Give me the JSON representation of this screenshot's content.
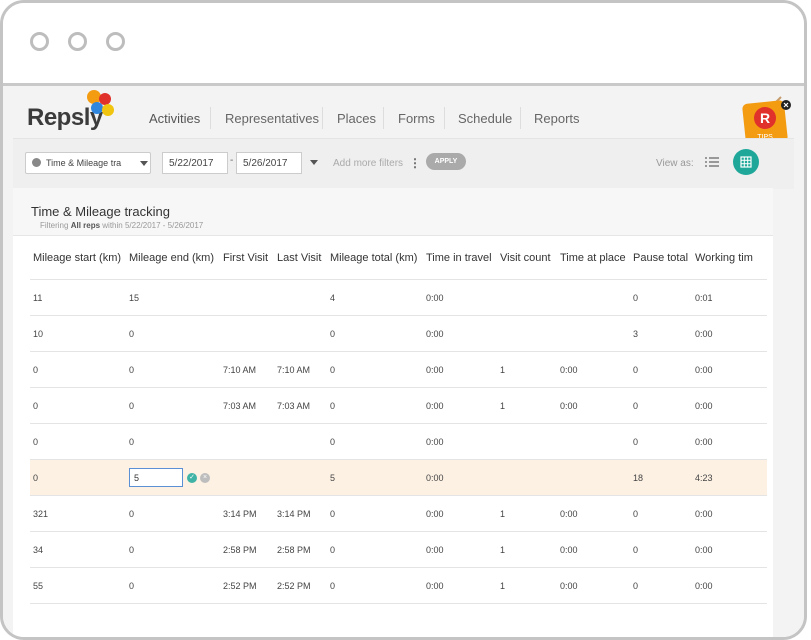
{
  "app": {
    "logo": "Repsly"
  },
  "nav": {
    "items": [
      "Activities",
      "Representatives",
      "Places",
      "Forms",
      "Schedule",
      "Reports"
    ]
  },
  "tips": {
    "label": "TIPS",
    "letter": "R"
  },
  "filters": {
    "report_select": "Time & Mileage tra",
    "date_from": "5/22/2017",
    "date_sep": "-",
    "date_to": "5/26/2017",
    "add_more": "Add more filters",
    "apply": "APPLY",
    "view_as": "View as:"
  },
  "panel": {
    "title": "Time & Mileage tracking",
    "subtitle_prefix": "Filtering",
    "subtitle_reps": "All reps",
    "subtitle_within": "within",
    "subtitle_range": "5/22/2017 - 5/26/2017"
  },
  "table": {
    "columns": [
      "Mileage start (km)",
      "Mileage end (km)",
      "First Visit",
      "Last Visit",
      "Mileage total (km)",
      "Time in travel",
      "Visit count",
      "Time at place",
      "Pause total",
      "Working tim"
    ],
    "rows": [
      [
        "11",
        "15",
        "",
        "",
        "4",
        "0:00",
        "",
        "",
        "0",
        "0:01"
      ],
      [
        "10",
        "0",
        "",
        "",
        "0",
        "0:00",
        "",
        "",
        "3",
        "0:00"
      ],
      [
        "0",
        "0",
        "7:10 AM",
        "7:10 AM",
        "0",
        "0:00",
        "1",
        "0:00",
        "0",
        "0:00"
      ],
      [
        "0",
        "0",
        "7:03 AM",
        "7:03 AM",
        "0",
        "0:00",
        "1",
        "0:00",
        "0",
        "0:00"
      ],
      [
        "0",
        "0",
        "",
        "",
        "0",
        "0:00",
        "",
        "",
        "0",
        "0:00"
      ],
      [
        "0",
        "5",
        "",
        "",
        "5",
        "0:00",
        "",
        "",
        "18",
        "4:23"
      ],
      [
        "321",
        "0",
        "3:14 PM",
        "3:14 PM",
        "0",
        "0:00",
        "1",
        "0:00",
        "0",
        "0:00"
      ],
      [
        "34",
        "0",
        "2:58 PM",
        "2:58 PM",
        "0",
        "0:00",
        "1",
        "0:00",
        "0",
        "0:00"
      ],
      [
        "55",
        "0",
        "2:52 PM",
        "2:52 PM",
        "0",
        "0:00",
        "1",
        "0:00",
        "0",
        "0:00"
      ]
    ],
    "editing_row_index": 5
  },
  "colors": {
    "accent": "#1fa89a",
    "tips_orange": "#f39c12",
    "tips_red": "#e0312b",
    "edit_row": "#fdf1e4"
  }
}
